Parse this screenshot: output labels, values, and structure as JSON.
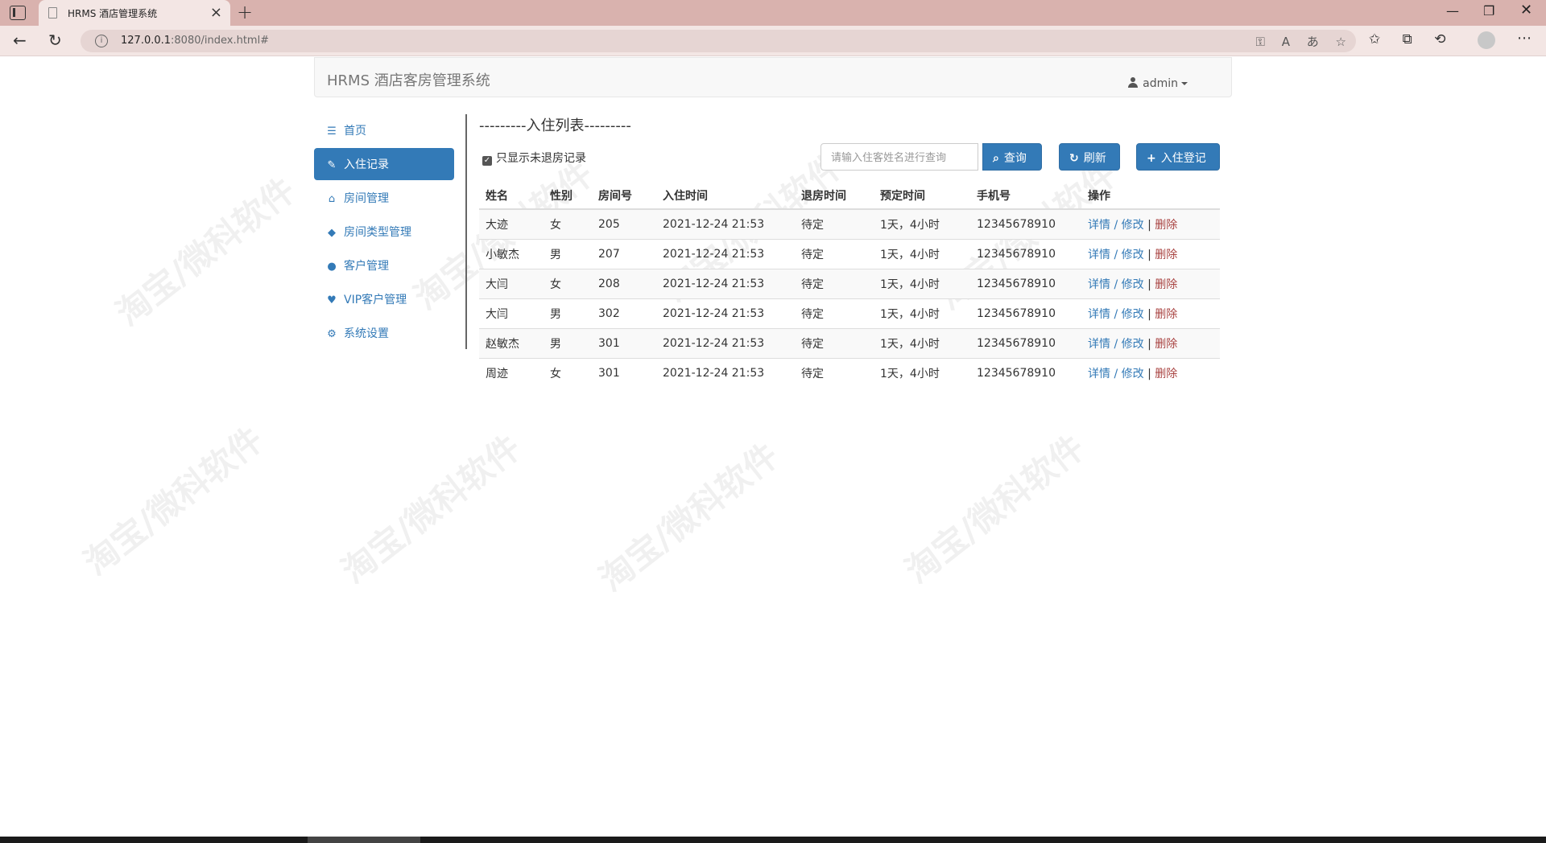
{
  "browser": {
    "tab_title": "HRMS 酒店管理系统",
    "url_host": "127.0.0.1",
    "url_rest": ":8080/index.html#"
  },
  "app": {
    "brand": "HRMS 酒店客房管理系统",
    "user": "admin"
  },
  "sidebar": {
    "items": [
      {
        "label": "首页",
        "icon": "list-icon"
      },
      {
        "label": "入住记录",
        "icon": "pencil-icon"
      },
      {
        "label": "房间管理",
        "icon": "home-icon"
      },
      {
        "label": "房间类型管理",
        "icon": "tags-icon"
      },
      {
        "label": "客户管理",
        "icon": "user-icon"
      },
      {
        "label": "VIP客户管理",
        "icon": "heart-icon"
      },
      {
        "label": "系统设置",
        "icon": "gear-icon"
      }
    ]
  },
  "main": {
    "title": "---------入住列表---------",
    "checkbox_label": "只显示未退房记录",
    "search_placeholder": "请输入住客姓名进行查询",
    "btn_search": "查询",
    "btn_refresh": "刷新",
    "btn_add": "入住登记",
    "columns": [
      "姓名",
      "性别",
      "房间号",
      "入住时间",
      "退房时间",
      "预定时间",
      "手机号",
      "操作"
    ],
    "rows": [
      {
        "name": "大迹",
        "sex": "女",
        "room": "205",
        "checkin": "2021-12-24 21:53",
        "checkout": "待定",
        "reserve": "1天，4小时",
        "phone": "12345678910"
      },
      {
        "name": "小敏杰",
        "sex": "男",
        "room": "207",
        "checkin": "2021-12-24 21:53",
        "checkout": "待定",
        "reserve": "1天，4小时",
        "phone": "12345678910"
      },
      {
        "name": "大闫",
        "sex": "女",
        "room": "208",
        "checkin": "2021-12-24 21:53",
        "checkout": "待定",
        "reserve": "1天，4小时",
        "phone": "12345678910"
      },
      {
        "name": "大闫",
        "sex": "男",
        "room": "302",
        "checkin": "2021-12-24 21:53",
        "checkout": "待定",
        "reserve": "1天，4小时",
        "phone": "12345678910"
      },
      {
        "name": "赵敏杰",
        "sex": "男",
        "room": "301",
        "checkin": "2021-12-24 21:53",
        "checkout": "待定",
        "reserve": "1天，4小时",
        "phone": "12345678910"
      },
      {
        "name": "周迹",
        "sex": "女",
        "room": "301",
        "checkin": "2021-12-24 21:53",
        "checkout": "待定",
        "reserve": "1天，4小时",
        "phone": "12345678910"
      }
    ],
    "actions": {
      "detail": "详情",
      "edit": "修改",
      "delete": "删除"
    }
  },
  "watermark": "淘宝/微科软件",
  "colors": {
    "primary": "#337ab7",
    "danger": "#a94442",
    "tabbar": "#d9b2ae"
  }
}
